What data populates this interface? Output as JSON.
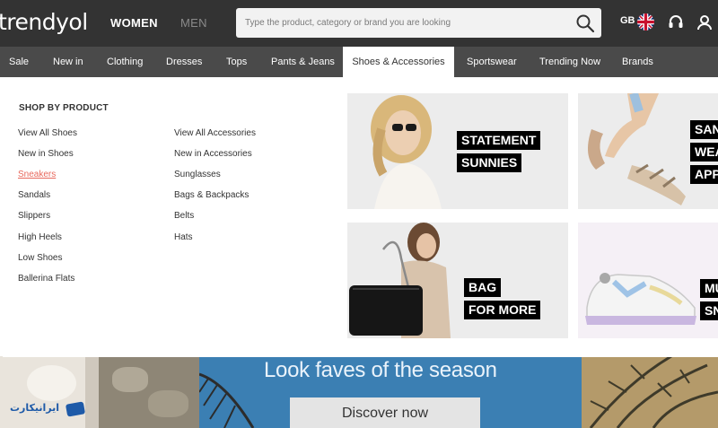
{
  "header": {
    "logo": "trendyol",
    "gender_tabs": [
      "WOMEN",
      "MEN"
    ],
    "search_placeholder": "Type the product, category or brand you are looking",
    "locale": "GB"
  },
  "nav": {
    "items": [
      "Sale",
      "New in",
      "Clothing",
      "Dresses",
      "Tops",
      "Pants & Jeans",
      "Shoes & Accessories",
      "Sportswear",
      "Trending Now",
      "Brands"
    ],
    "active": "Shoes & Accessories"
  },
  "menu": {
    "heading": "SHOP BY PRODUCT",
    "shoes": [
      "View All Shoes",
      "New in Shoes",
      "Sneakers",
      "Sandals",
      "Slippers",
      "High Heels",
      "Low Shoes",
      "Ballerina Flats"
    ],
    "accessories": [
      "View All Accessories",
      "New in Accessories",
      "Sunglasses",
      "Bags & Backpacks",
      "Belts",
      "Hats"
    ],
    "hovered": "Sneakers"
  },
  "promos": [
    {
      "lines": [
        "STATEMENT",
        "SUNNIES"
      ]
    },
    {
      "lines": [
        "SAN",
        "WEA",
        "APP"
      ]
    },
    {
      "lines": [
        "BAG",
        "FOR MORE"
      ]
    },
    {
      "lines": [
        "MU",
        "SN"
      ]
    }
  ],
  "hero": {
    "title": "Look faves of the season",
    "button": "Discover now"
  },
  "watermark": "ایرانیکارت",
  "colors": {
    "header_bg": "#333333",
    "nav_bg": "#4a4a4a",
    "active_tab_bg": "#ffffff",
    "hover_link": "#e8685c",
    "hero_blue": "#3b7fb3"
  },
  "icons": [
    "search-icon",
    "uk-flag-icon",
    "headset-icon",
    "user-icon"
  ]
}
